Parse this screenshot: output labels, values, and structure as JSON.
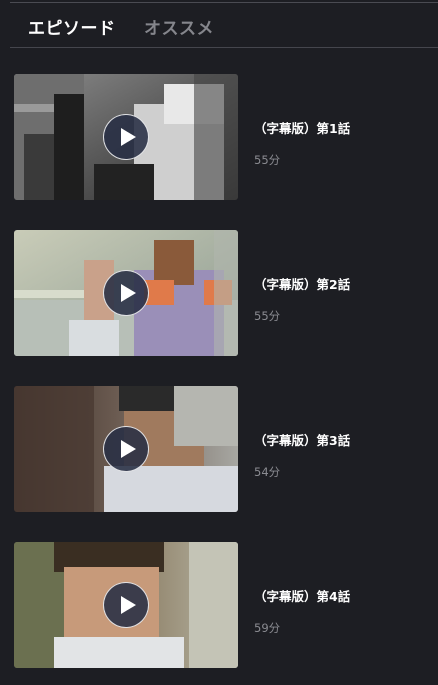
{
  "tabs": [
    {
      "label": "エピソード",
      "active": true
    },
    {
      "label": "オススメ",
      "active": false
    }
  ],
  "episodes": [
    {
      "title": "（字幕版）第1話",
      "duration": "55分"
    },
    {
      "title": "（字幕版）第2話",
      "duration": "55分"
    },
    {
      "title": "（字幕版）第3話",
      "duration": "54分"
    },
    {
      "title": "（字幕版）第4話",
      "duration": "59分"
    }
  ],
  "colors": {
    "background": "#1d1e23",
    "title_text": "#ffffff",
    "muted_text": "#8a8b91",
    "play_button": "#282f44"
  },
  "icons": {
    "play": "play-icon"
  }
}
